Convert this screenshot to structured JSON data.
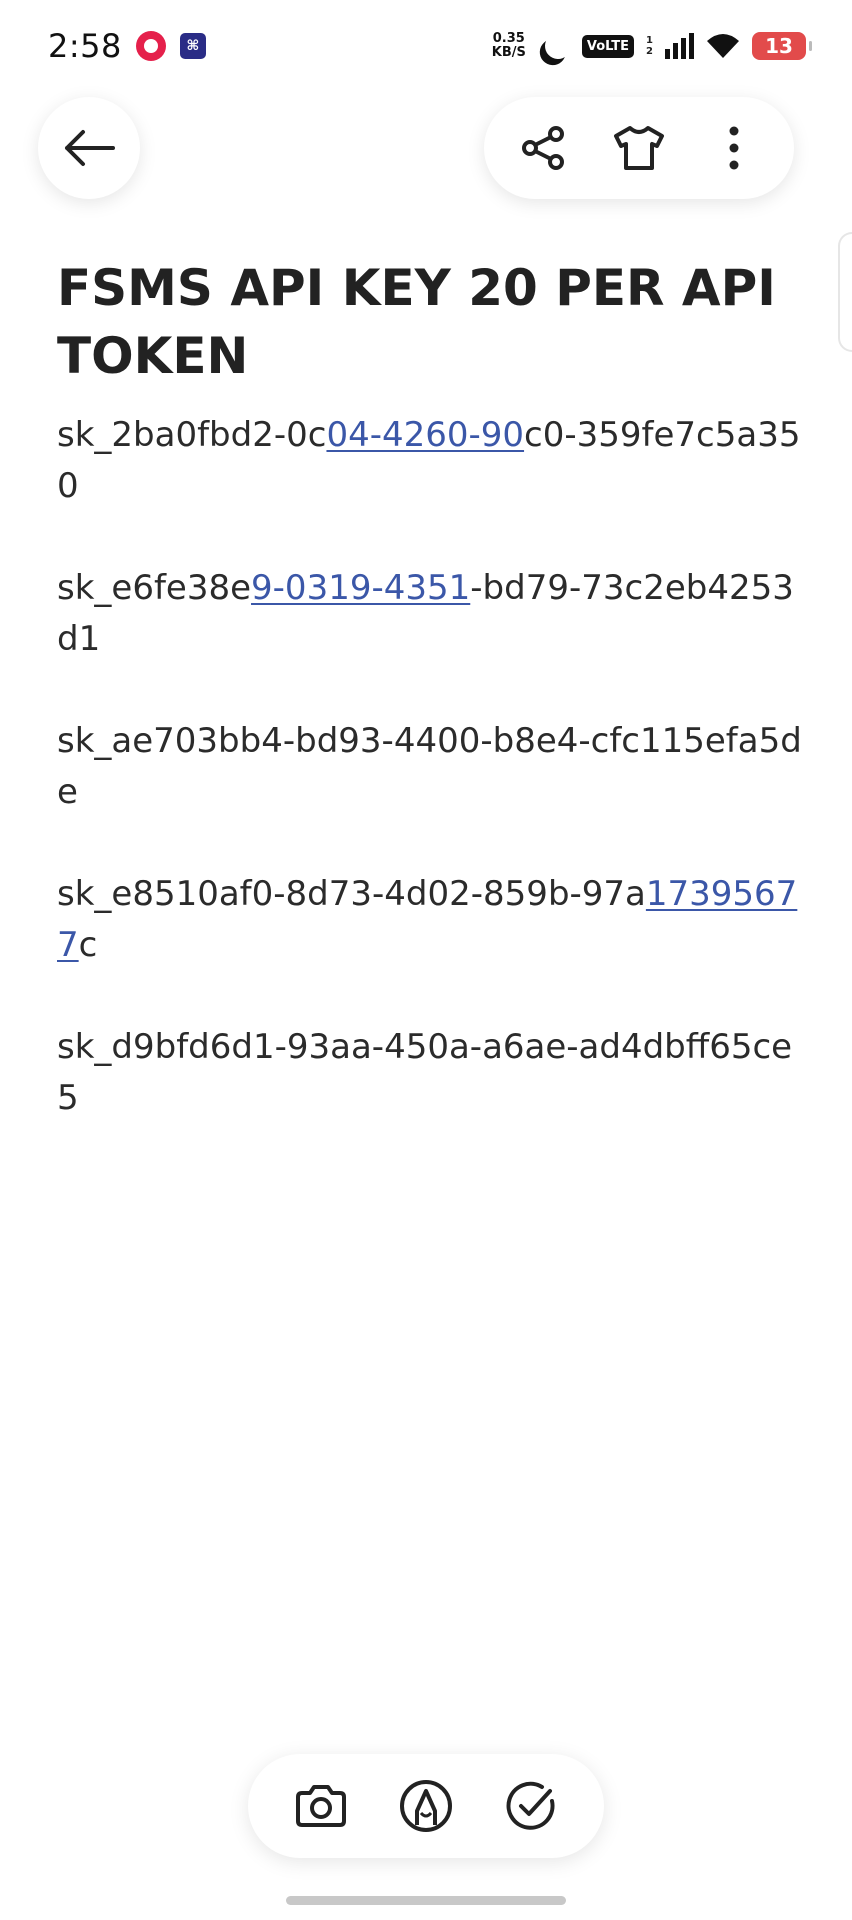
{
  "status_bar": {
    "time": "2:58",
    "net_speed_value": "0.35",
    "net_speed_unit": "KB/S",
    "volte": "VoLTE",
    "sim_1": "1",
    "sim_2": "2",
    "battery": "13"
  },
  "header": {
    "back_icon": "arrow-left-icon",
    "share_icon": "share-icon",
    "theme_icon": "shirt-icon",
    "more_icon": "more-vertical-icon"
  },
  "note": {
    "title": "FSMS API KEY 20 PER API TOKEN",
    "keys": [
      {
        "pre": "sk_2ba0fbd2-0c",
        "link": "04-4260-90",
        "post": "c0-359fe7c5a350"
      },
      {
        "pre": "sk_e6fe38e",
        "link": "9-0319-4351",
        "post": "-bd79-73c2eb4253d1"
      },
      {
        "pre": "sk_ae703bb4-bd93-4400-b8e4-cfc115efa5de",
        "link": "",
        "post": ""
      },
      {
        "pre": "sk_e8510af0-8d73-4d02-859b-97a",
        "link": "17395677",
        "post": "c"
      },
      {
        "pre": "sk_d9bfd6d1-93aa-450a-a6ae-ad4dbff65ce5",
        "link": "",
        "post": ""
      }
    ]
  },
  "bottom_bar": {
    "camera_icon": "camera-icon",
    "pen_icon": "pen-icon",
    "check_icon": "check-circle-icon"
  },
  "colors": {
    "link": "#3b57a8",
    "text": "#2b2b2b",
    "battery_low": "#e24b4b"
  }
}
